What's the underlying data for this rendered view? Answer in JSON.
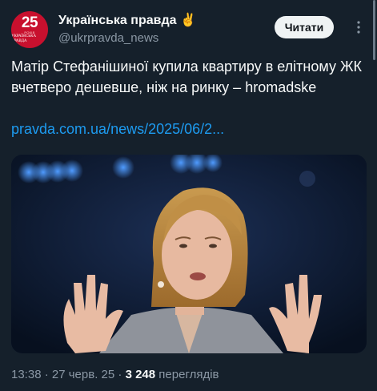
{
  "author": {
    "name": "Українська правда ✌️",
    "handle": "@ukrpravda_news",
    "avatar": {
      "number": "25",
      "caption_small": "РОКІВ",
      "caption_brand": "УКРАЇНСЬКА ПРАВДА",
      "color": "#c8102e"
    }
  },
  "actions": {
    "read_label": "Читати",
    "more_icon": "more-vertical-icon"
  },
  "post": {
    "text": "Матір Стефанішиної купила квартиру в елітному ЖК вчетверо дешевше, ніж на ринку – hromadske",
    "link": "pravda.com.ua/news/2025/06/2..."
  },
  "meta": {
    "time": "13:38",
    "sep1": " · ",
    "date": "27 черв. 25",
    "sep2": " · ",
    "views_count": "3 248",
    "views_label": " переглядів"
  },
  "colors": {
    "background": "#15202b",
    "text": "#f7f9f9",
    "secondary": "#8b98a5",
    "link": "#1d9bf0"
  }
}
